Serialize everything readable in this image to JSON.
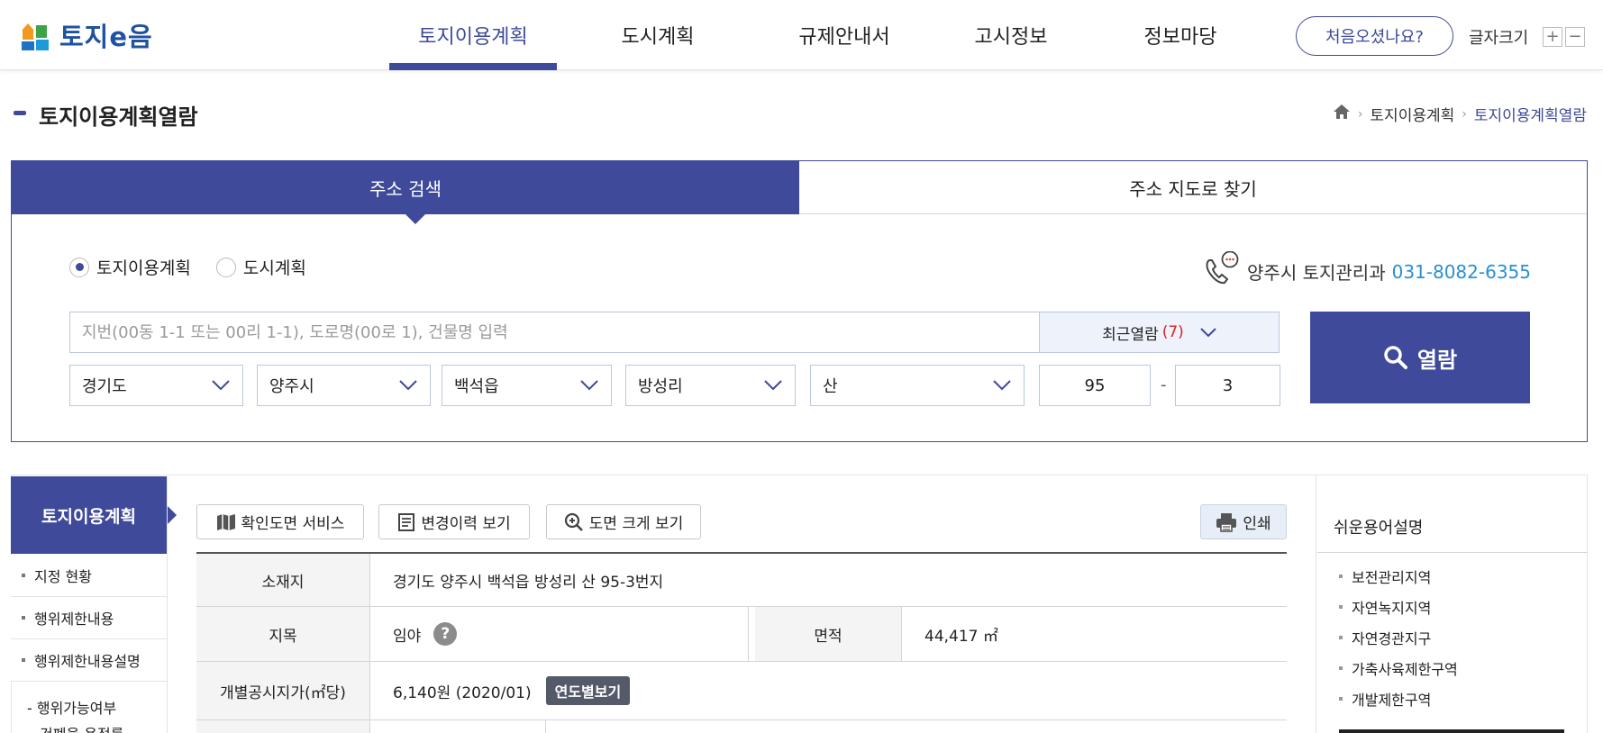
{
  "header": {
    "logo_text": "토지e음",
    "menu": [
      "토지이용계획",
      "도시계획",
      "규제안내서",
      "고시정보",
      "정보마당"
    ],
    "first_visit_label": "처음오셨나요?",
    "font_size_label": "글자크기",
    "font_plus": "+",
    "font_minus": "−"
  },
  "page": {
    "title": "토지이용계획열람",
    "breadcrumb": [
      "토지이용계획",
      "토지이용계획열람"
    ]
  },
  "search": {
    "tabs": [
      "주소 검색",
      "주소 지도로 찾기"
    ],
    "radio_options": [
      "토지이용계획",
      "도시계획"
    ],
    "selected_radio": "토지이용계획",
    "contact_label": "양주시 토지관리과",
    "contact_phone": "031-8082-6355",
    "placeholder": "지번(00동 1-1 또는 00리 1-1), 도로명(00로 1), 건물명 입력",
    "recent_label": "최근열람",
    "recent_count": "(7)",
    "search_button": "열람",
    "selects": [
      "경기도",
      "양주시",
      "백석읍",
      "방성리",
      "산"
    ],
    "main_number": "95",
    "dash": "-",
    "sub_number": "3"
  },
  "lnb": {
    "head": "토지이용계획",
    "items": [
      "지정 현황",
      "행위제한내용",
      "행위제한내용설명"
    ],
    "sub_items": [
      "- 행위가능여부",
      "건폐율·용적률"
    ]
  },
  "tools": {
    "confirm_map": "확인도면 서비스",
    "history": "변경이력 보기",
    "enlarge": "도면 크게 보기",
    "print": "인쇄"
  },
  "info": {
    "location_label": "소재지",
    "location_value": "경기도 양주시 백석읍 방성리 산 95-3번지",
    "category_label": "지목",
    "category_value": "임야",
    "help": "?",
    "area_label": "면적",
    "area_value": "44,417 ㎡",
    "price_label": "개별공시지가(㎡당)",
    "price_value": "6,140원 (2020/01)",
    "yearly_button": "연도별보기"
  },
  "terms": {
    "title": "쉬운용어설명",
    "items": [
      "보전관리지역",
      "자연녹지지역",
      "자연경관지구",
      "가축사육제한구역",
      "개발제한구역"
    ]
  },
  "colors": {
    "primary": "#3f4a9a",
    "phone": "#2a8fd6",
    "recent_count": "#dd2222"
  }
}
